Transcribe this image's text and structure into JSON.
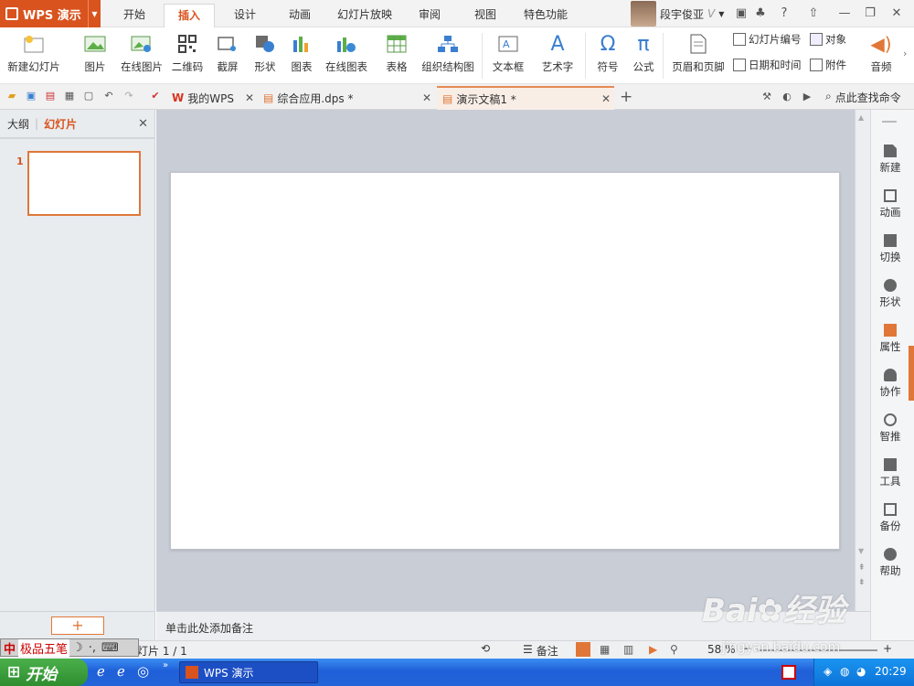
{
  "app": {
    "title": "WPS 演示"
  },
  "menu_tabs": [
    "开始",
    "插入",
    "设计",
    "动画",
    "幻灯片放映",
    "审阅",
    "视图",
    "特色功能"
  ],
  "active_tab": "插入",
  "user": {
    "name": "段宇俊亚",
    "badge": "V",
    "help": "?"
  },
  "ribbon": {
    "new_slide": "新建幻灯片",
    "picture": "图片",
    "online_picture": "在线图片",
    "qrcode": "二维码",
    "screenshot": "截屏",
    "shape": "形状",
    "chart": "图表",
    "online_chart": "在线图表",
    "table": "表格",
    "org_chart": "组织结构图",
    "textbox": "文本框",
    "wordart": "艺术字",
    "symbol": "符号",
    "formula": "公式",
    "header_footer": "页眉和页脚",
    "slide_number": "幻灯片编号",
    "datetime": "日期和时间",
    "object": "对象",
    "attachment": "附件",
    "audio": "音频"
  },
  "doc_tabs": [
    {
      "label": "我的WPS"
    },
    {
      "label": "综合应用.dps *"
    },
    {
      "label": "演示文稿1 *"
    }
  ],
  "find_command": "点此查找命令",
  "left_panel": {
    "outline": "大纲",
    "slides": "幻灯片",
    "slide_number": "1"
  },
  "notes_placeholder": "单击此处添加备注",
  "right_sidebar": [
    "新建",
    "动画",
    "切换",
    "形状",
    "属性",
    "协作",
    "智推",
    "工具",
    "备份",
    "帮助"
  ],
  "status": {
    "slide_info": "灯片 1 / 1",
    "notes": "备注",
    "zoom": "58 %"
  },
  "ime": {
    "name": "极品五笔"
  },
  "taskbar": {
    "start": "开始",
    "task": "WPS 演示",
    "clock": "20:29"
  },
  "watermark": {
    "brand": "Bai",
    "brand2": "经验",
    "url": "jingyan.baidu.com"
  },
  "colors": {
    "accent": "#d9531e",
    "slide_border": "#e07738",
    "taskbar": "#2364d9"
  }
}
